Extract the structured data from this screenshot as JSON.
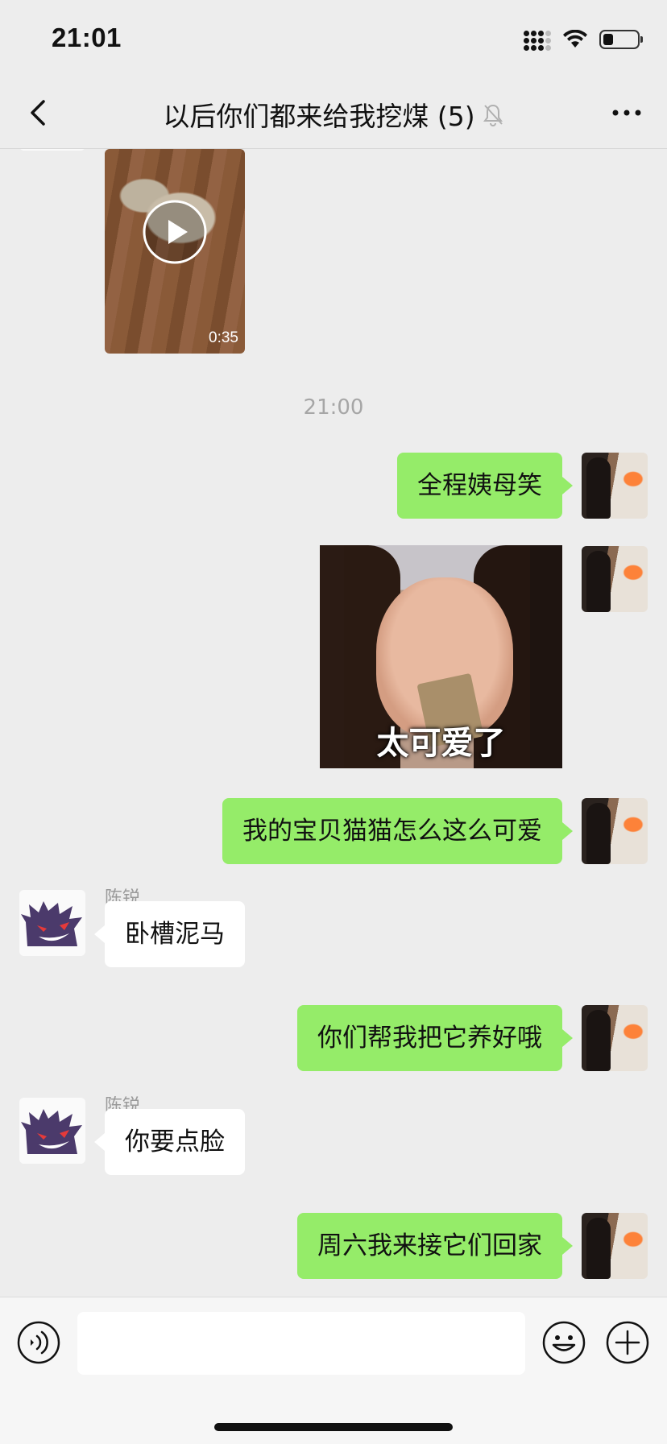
{
  "status_bar": {
    "time": "21:01",
    "battery_level": 0.3
  },
  "header": {
    "title": "以后你们都来给我挖煤 (5)",
    "muted": true
  },
  "video": {
    "duration": "0:35"
  },
  "timestamp": "21:00",
  "sticker": {
    "caption": "太可爱了"
  },
  "messages": [
    {
      "sender": "me",
      "text": "全程姨母笑"
    },
    {
      "sender": "me",
      "text": "我的宝贝猫猫怎么这么可爱"
    },
    {
      "sender": "陈锐",
      "text": "卧槽泥马"
    },
    {
      "sender": "me",
      "text": "你们帮我把它养好哦"
    },
    {
      "sender": "陈锐",
      "text": "你要点脸"
    },
    {
      "sender": "me",
      "text": "周六我来接它们回家"
    }
  ],
  "colors": {
    "bubble_me": "#95ec69",
    "bubble_other": "#ffffff",
    "background": "#ededed"
  },
  "input": {
    "value": "",
    "placeholder": ""
  }
}
